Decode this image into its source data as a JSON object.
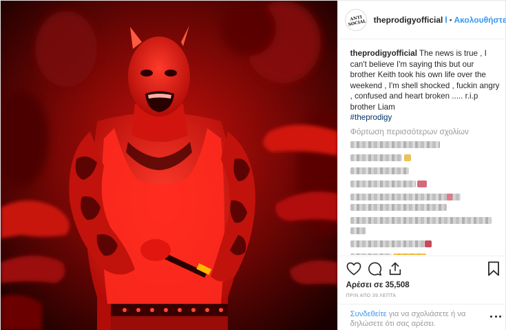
{
  "header": {
    "avatar_lines": [
      "ANTI",
      "SOCIAL"
    ],
    "username": "theprodigyofficial",
    "separator": "•",
    "follow_label": "Ακολουθήστε"
  },
  "caption": {
    "username": "theprodigyofficial",
    "text": "The news is true , I can't believe I'm saying this but our brother Keith took his own life over the weekend , I'm shell shocked , fuckin angry , confused and heart broken ..... r.i.p brother Liam",
    "hashtag": "#theprodigy"
  },
  "comments": {
    "load_more_label": "Φόρτωση περισσότερων σχολίων",
    "blurred_rows": 11
  },
  "actions": {
    "likes_label": "Αρέσει σε 35,508",
    "time_label": "ΠΡΙΝ ΑΠΟ 39 ΛΕΠΤΑ"
  },
  "add_comment": {
    "login_label": "Συνδεθείτε",
    "rest_label": " για να σχολιάσετε ή να δηλώσετε ότι σας αρέσει."
  },
  "colors": {
    "accent_blue": "#3897f0",
    "hashtag_blue": "#003569",
    "photo_red": "#e0140f"
  },
  "icons": [
    "heart-icon",
    "comment-icon",
    "share-icon",
    "bookmark-icon",
    "more-options-icon",
    "verified-badge-icon"
  ]
}
